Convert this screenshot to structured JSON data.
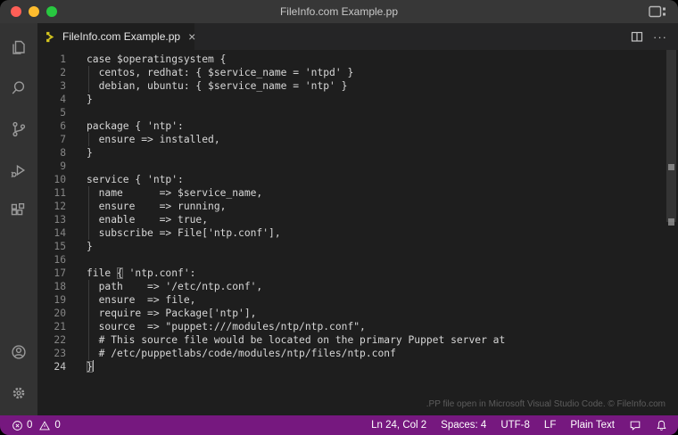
{
  "titlebar": {
    "title": "FileInfo.com Example.pp",
    "window_controls": [
      "close",
      "minimize",
      "zoom"
    ]
  },
  "tab": {
    "label": "FileInfo.com Example.pp",
    "close_glyph": "×",
    "file_icon": "puppet-file-icon"
  },
  "editor_actions": {
    "split_icon": "split-editor-icon",
    "more_glyph": "···"
  },
  "activity_bar": {
    "items": [
      {
        "name": "explorer",
        "icon": "files-icon"
      },
      {
        "name": "search",
        "icon": "search-icon"
      },
      {
        "name": "source-control",
        "icon": "git-branch-icon"
      },
      {
        "name": "run-and-debug",
        "icon": "debug-play-icon"
      },
      {
        "name": "extensions",
        "icon": "extensions-icon"
      }
    ],
    "bottom_items": [
      {
        "name": "accounts",
        "icon": "account-icon"
      },
      {
        "name": "settings",
        "icon": "gear-icon"
      }
    ]
  },
  "editor": {
    "lines": [
      "case $operatingsystem {",
      "  centos, redhat: { $service_name = 'ntpd' }",
      "  debian, ubuntu: { $service_name = 'ntp' }",
      "}",
      "",
      "package { 'ntp':",
      "  ensure => installed,",
      "}",
      "",
      "service { 'ntp':",
      "  name      => $service_name,",
      "  ensure    => running,",
      "  enable    => true,",
      "  subscribe => File['ntp.conf'],",
      "}",
      "",
      "file { 'ntp.conf':",
      "  path    => '/etc/ntp.conf',",
      "  ensure  => file,",
      "  require => Package['ntp'],",
      "  source  => \"puppet:///modules/ntp/ntp.conf\",",
      "  # This source file would be located on the primary Puppet server at",
      "  # /etc/puppetlabs/code/modules/ntp/files/ntp.conf",
      "}"
    ],
    "cursor": {
      "line": 24,
      "col": 2
    },
    "bracket_matches": [
      {
        "line": 17,
        "col": 5
      },
      {
        "line": 24,
        "col": 0
      }
    ],
    "watermark": ".PP file open in Microsoft Visual Studio Code. © FileInfo.com"
  },
  "status_bar": {
    "errors": "0",
    "warnings": "0",
    "cursor_position": "Ln 24, Col 2",
    "indentation": "Spaces: 4",
    "encoding": "UTF-8",
    "eol": "LF",
    "language_mode": "Plain Text",
    "icons": [
      "error-icon",
      "warning-icon",
      "feedback-icon",
      "bell-icon"
    ]
  },
  "colors": {
    "status_bar_bg": "#76187f",
    "title_bar_bg": "#373737",
    "activity_bar_bg": "#333333",
    "editor_bg": "#1e1e1e",
    "tab_strip_bg": "#252526",
    "puppet_icon_yellow": "#d3c41e",
    "traffic_red": "#ff5f57",
    "traffic_yellow": "#febc2e",
    "traffic_green": "#28c840"
  }
}
